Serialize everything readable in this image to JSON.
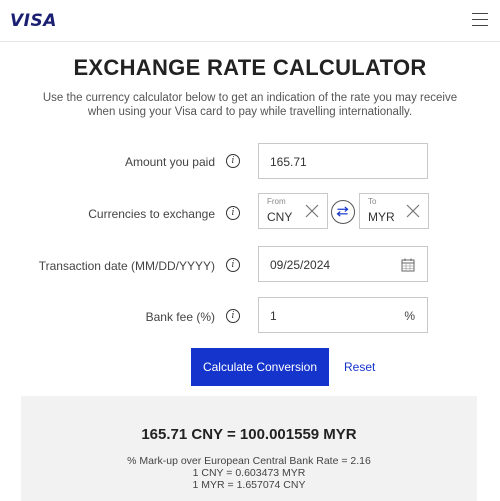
{
  "header": {
    "logo_text": "VISA",
    "menu_icon": "hamburger-menu-icon"
  },
  "page": {
    "title": "EXCHANGE RATE CALCULATOR",
    "subtitle_line1": "Use the currency calculator below to get an indication of the rate you may receive",
    "subtitle_line2": "when using your Visa card to pay while travelling internationally."
  },
  "form": {
    "amount": {
      "label": "Amount you paid",
      "value": "165.71"
    },
    "currencies": {
      "label": "Currencies to exchange",
      "from_label": "From",
      "from_value": "CNY",
      "to_label": "To",
      "to_value": "MYR"
    },
    "date": {
      "label": "Transaction date (MM/DD/YYYY)",
      "value": "09/25/2024"
    },
    "bank_fee": {
      "label": "Bank fee (%)",
      "value": "1",
      "unit": "%"
    },
    "info_glyph": "i"
  },
  "actions": {
    "calculate_label": "Calculate Conversion",
    "reset_label": "Reset"
  },
  "result": {
    "main": "165.71 CNY = 100.001559 MYR",
    "markup": "% Mark-up over European Central Bank Rate = 2.16",
    "rate1": "1 CNY = 0.603473 MYR",
    "rate2": "1 MYR = 1.657074 CNY"
  },
  "colors": {
    "brand": "#1a1f71",
    "accent": "#1434cb",
    "result_bg": "#f2f2f2"
  }
}
